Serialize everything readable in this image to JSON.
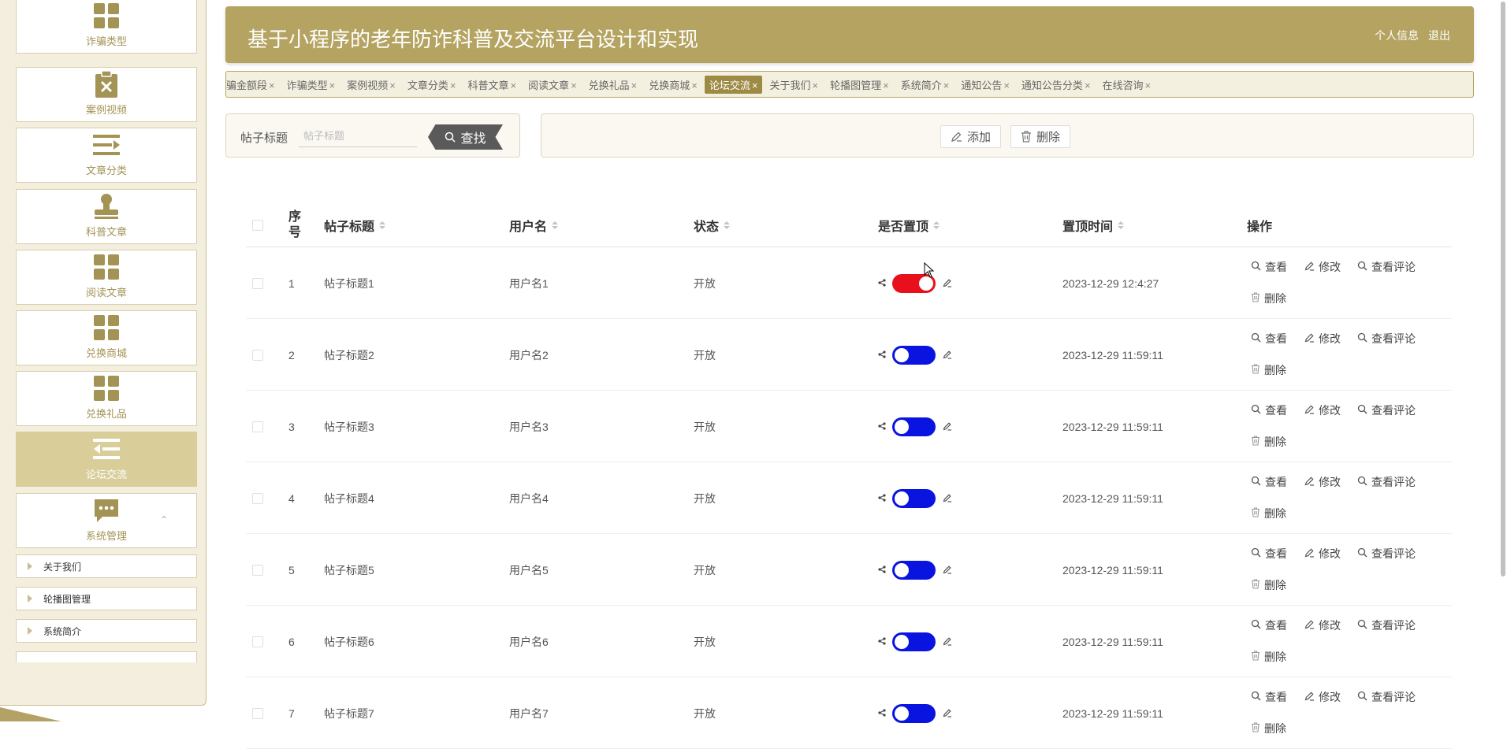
{
  "header": {
    "title": "基于小程序的老年防诈科普及交流平台设计和实现",
    "profile_link": "个人信息",
    "logout_link": "退出"
  },
  "sidebar": {
    "items": [
      {
        "label": "诈骗类型",
        "icon": "grid-icon"
      },
      {
        "label": "案例视频",
        "icon": "clipboard-x-icon"
      },
      {
        "label": "文章分类",
        "icon": "list-arrow-icon"
      },
      {
        "label": "科普文章",
        "icon": "stamp-icon"
      },
      {
        "label": "阅读文章",
        "icon": "grid-icon"
      },
      {
        "label": "兑换商城",
        "icon": "grid-icon"
      },
      {
        "label": "兑换礼品",
        "icon": "grid-icon"
      },
      {
        "label": "论坛交流",
        "icon": "outdent-icon",
        "active": true
      },
      {
        "label": "系统管理",
        "icon": "chat-icon",
        "expanded": true
      }
    ],
    "sub_items": [
      "关于我们",
      "轮播图管理",
      "系统简介"
    ]
  },
  "tabs": [
    {
      "label": "骗金额段"
    },
    {
      "label": "诈骗类型"
    },
    {
      "label": "案例视频"
    },
    {
      "label": "文章分类"
    },
    {
      "label": "科普文章"
    },
    {
      "label": "阅读文章"
    },
    {
      "label": "兑换礼品"
    },
    {
      "label": "兑换商城"
    },
    {
      "label": "论坛交流",
      "active": true
    },
    {
      "label": "关于我们"
    },
    {
      "label": "轮播图管理"
    },
    {
      "label": "系统简介"
    },
    {
      "label": "通知公告"
    },
    {
      "label": "通知公告分类"
    },
    {
      "label": "在线咨询"
    }
  ],
  "tab_close": "×",
  "search": {
    "label": "帖子标题",
    "placeholder": "帖子标题",
    "button": "查找"
  },
  "actions": {
    "add": "添加",
    "delete": "删除"
  },
  "table": {
    "headers": {
      "index": "序号",
      "title": "帖子标题",
      "username": "用户名",
      "status": "状态",
      "pinned": "是否置顶",
      "pinned_time": "置顶时间",
      "ops": "操作"
    },
    "op_labels": {
      "view": "查看",
      "edit": "修改",
      "comments": "查看评论",
      "delete": "删除"
    },
    "rows": [
      {
        "index": "1",
        "title": "帖子标题1",
        "username": "用户名1",
        "status": "开放",
        "pinned": true,
        "time": "2023-12-29 12:4:27"
      },
      {
        "index": "2",
        "title": "帖子标题2",
        "username": "用户名2",
        "status": "开放",
        "pinned": false,
        "time": "2023-12-29 11:59:11"
      },
      {
        "index": "3",
        "title": "帖子标题3",
        "username": "用户名3",
        "status": "开放",
        "pinned": false,
        "time": "2023-12-29 11:59:11"
      },
      {
        "index": "4",
        "title": "帖子标题4",
        "username": "用户名4",
        "status": "开放",
        "pinned": false,
        "time": "2023-12-29 11:59:11"
      },
      {
        "index": "5",
        "title": "帖子标题5",
        "username": "用户名5",
        "status": "开放",
        "pinned": false,
        "time": "2023-12-29 11:59:11"
      },
      {
        "index": "6",
        "title": "帖子标题6",
        "username": "用户名6",
        "status": "开放",
        "pinned": false,
        "time": "2023-12-29 11:59:11"
      },
      {
        "index": "7",
        "title": "帖子标题7",
        "username": "用户名7",
        "status": "开放",
        "pinned": false,
        "time": "2023-12-29 11:59:11"
      }
    ]
  },
  "colors": {
    "brand": "#b5a461",
    "switch_on": "#e8101c",
    "switch_off": "#0a14e0"
  }
}
